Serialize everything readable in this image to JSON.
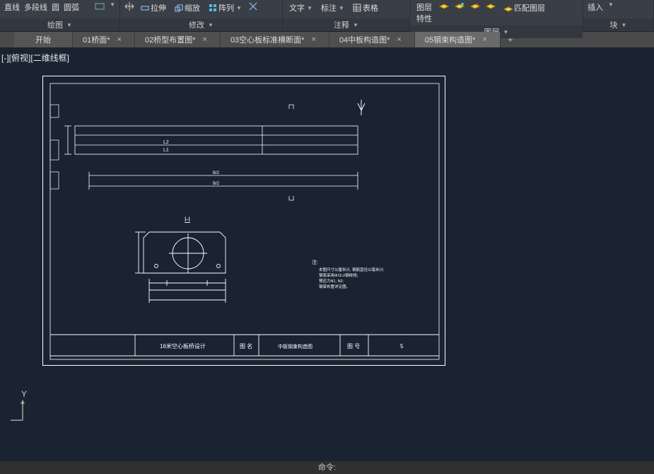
{
  "ribbon": {
    "panel1": {
      "labels": [
        "直线",
        "多段线",
        "圆",
        "圆弧"
      ],
      "title": "绘图"
    },
    "panel2": {
      "btns": [
        "拉伸",
        "缩放",
        "阵列"
      ],
      "title": "修改"
    },
    "panel3": {
      "btns": [
        "文字",
        "标注",
        "表格"
      ],
      "title": "注释"
    },
    "panel4": {
      "btns": [
        "图层特性",
        "匹配图层"
      ],
      "title": "图层"
    },
    "panel5": {
      "btns": [
        "插入"
      ],
      "title": "块"
    }
  },
  "tabs": {
    "start": "开始",
    "items": [
      {
        "label": "01桥面*"
      },
      {
        "label": "02桥型布置图*"
      },
      {
        "label": "03空心板标准横断面*"
      },
      {
        "label": "04中板构造图*"
      },
      {
        "label": "05钢束构造图*",
        "active": true
      }
    ]
  },
  "view_label": "[-][俯视][二维线框]",
  "drawing": {
    "section_label": "I-I",
    "dim_labels": {
      "l1": "L1",
      "l2": "L2",
      "b2a": "B/2",
      "b2b": "B/2"
    },
    "titleblock": {
      "project": "16米空心板桥设计",
      "name_h": "图 名",
      "name": "中板钢束构造图",
      "no_h": "图 号",
      "no": "5"
    },
    "notes_title": "注:",
    "notes": [
      "本图尺寸以厘米计, 钢筋直径以毫米计;",
      "钢束采用Φ15.2钢绞线;",
      "预应力N1, N2;",
      "钢束布置详见图。"
    ]
  },
  "cmd_prompt": "命令:",
  "ucs_y": "Y"
}
